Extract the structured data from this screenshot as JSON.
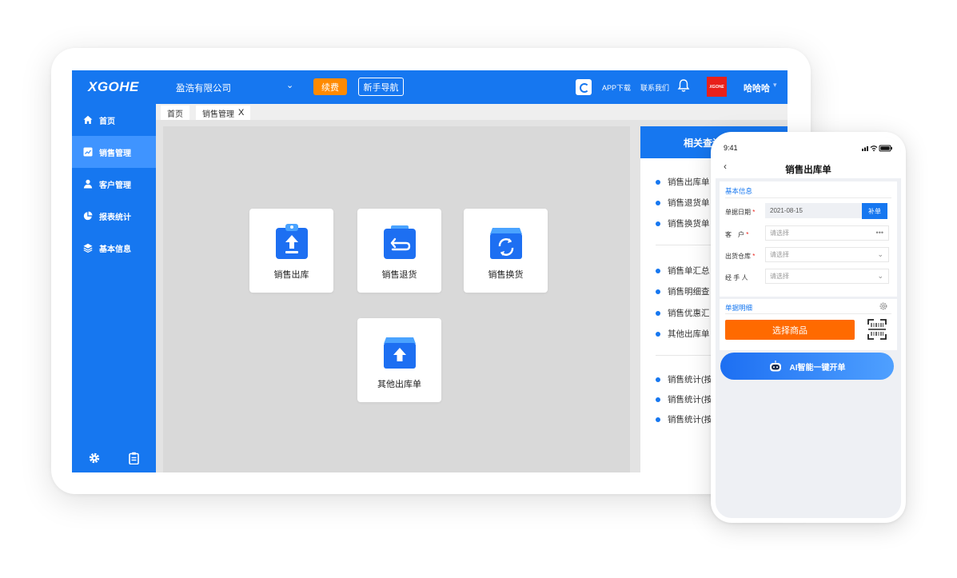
{
  "topbar": {
    "logo": "XGOHE",
    "company": "盈浩有限公司",
    "company_caret": "⌄",
    "renew_label": "续费",
    "guide_label": "新手导航",
    "app_download": "APP下载",
    "contact": "联系我们",
    "username": "哈哈哈",
    "user_caret": "▾"
  },
  "sidebar": {
    "items": [
      {
        "label": "首页",
        "icon": "home-icon"
      },
      {
        "label": "销售管理",
        "icon": "chart-icon",
        "active": true
      },
      {
        "label": "客户管理",
        "icon": "user-icon"
      },
      {
        "label": "报表统计",
        "icon": "pie-icon"
      },
      {
        "label": "基本信息",
        "icon": "layers-icon"
      }
    ]
  },
  "tabs": [
    {
      "label": "首页"
    },
    {
      "label": "销售管理",
      "close": "X"
    }
  ],
  "tiles": [
    {
      "label": "销售出库",
      "icon": "upload-clipboard-icon"
    },
    {
      "label": "销售退货",
      "icon": "return-box-icon"
    },
    {
      "label": "销售换货",
      "icon": "exchange-box-icon"
    },
    {
      "label": "其他出库单",
      "icon": "outbound-box-icon"
    }
  ],
  "right_panel": {
    "title": "相关查询",
    "group1": [
      "销售出库单",
      "销售退货单",
      "销售换货单"
    ],
    "group2": [
      "销售单汇总",
      "销售明细查",
      "销售优惠汇",
      "其他出库单"
    ],
    "group3": [
      "销售统计(按",
      "销售统计(按",
      "销售统计(按"
    ]
  },
  "phone": {
    "time": "9:41",
    "back": "‹",
    "title": "销售出库单",
    "basic_section": "基本信息",
    "fields": [
      {
        "label": "单据日期",
        "required": "*",
        "value": "2021-08-15"
      },
      {
        "label": "客　户",
        "required": "*",
        "placeholder": "请选择",
        "icon": "•••"
      },
      {
        "label": "出货仓库",
        "required": "*",
        "placeholder": "请选择",
        "icon": "⌄"
      },
      {
        "label": "经 手 人",
        "required": "",
        "placeholder": "请选择",
        "icon": "⌄"
      }
    ],
    "add_btn": "补单",
    "detail_section": "单据明细",
    "select_goods": "选择商品",
    "ai_btn": "AI智能一键开单"
  },
  "colors": {
    "brand_blue": "#1677f0",
    "orange": "#ff8a00",
    "select_orange": "#ff6a00"
  }
}
